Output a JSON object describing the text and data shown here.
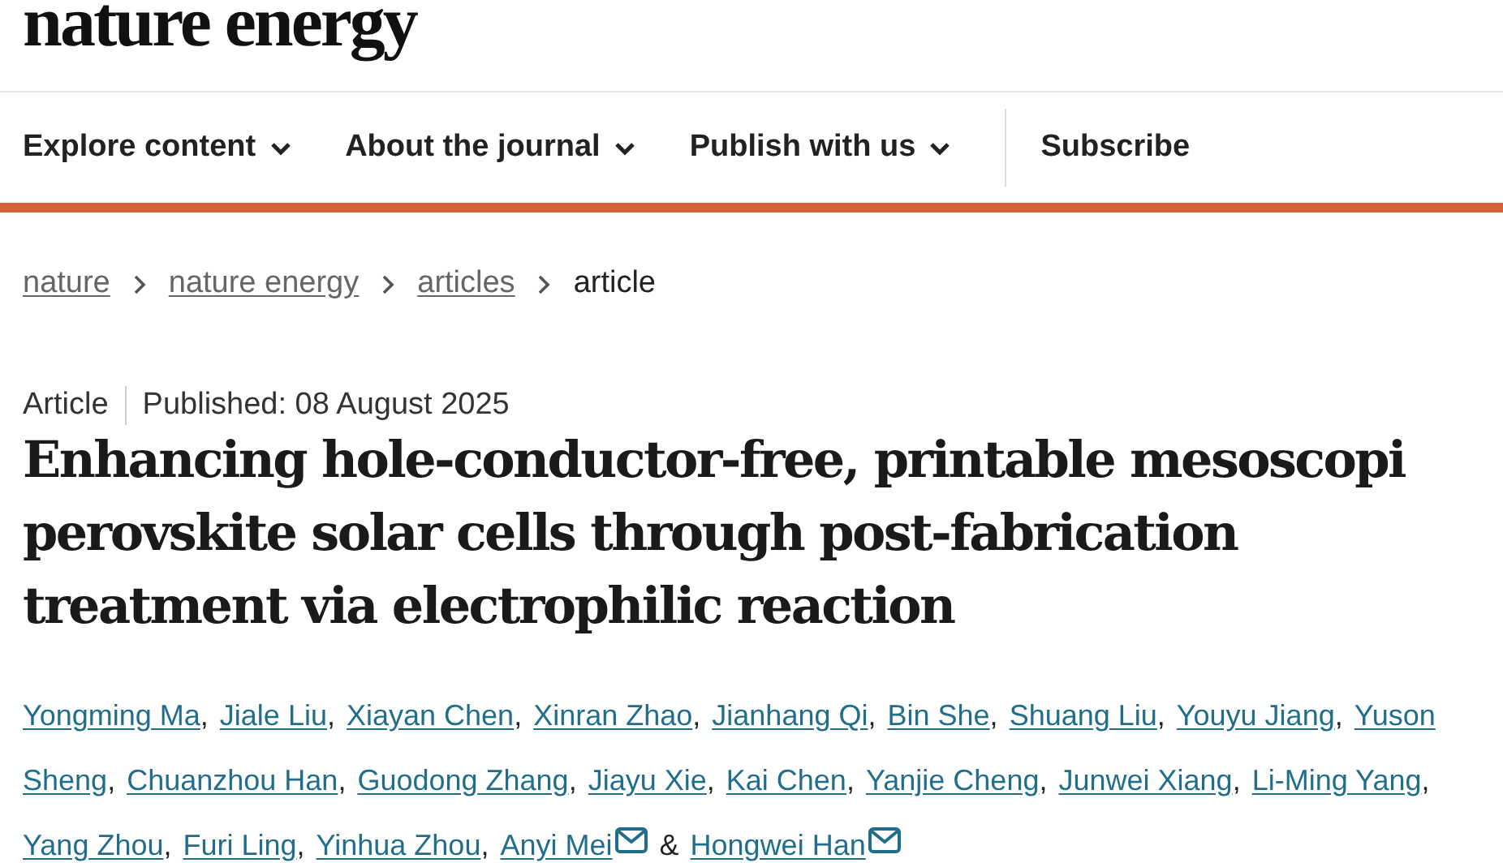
{
  "logo": "nature energy",
  "nav": [
    {
      "label": "Explore content",
      "dropdown": true
    },
    {
      "label": "About the journal",
      "dropdown": true
    },
    {
      "label": "Publish with us",
      "dropdown": true
    },
    {
      "label": "Subscribe",
      "dropdown": false
    }
  ],
  "breadcrumbs": [
    {
      "label": "nature",
      "link": true
    },
    {
      "label": "nature energy",
      "link": true
    },
    {
      "label": "articles",
      "link": true
    },
    {
      "label": "article",
      "link": false
    }
  ],
  "article_type": "Article",
  "published": "Published: 08 August 2025",
  "title_lines": [
    "Enhancing hole-conductor-free, printable mesoscopi",
    "perovskite solar cells through post-fabrication",
    "treatment via electrophilic reaction"
  ],
  "author_lines": [
    [
      {
        "name": "Yongming Ma",
        "sep": ",",
        "email": false
      },
      {
        "name": "Jiale Liu",
        "sep": ",",
        "email": false
      },
      {
        "name": "Xiayan Chen",
        "sep": ",",
        "email": false
      },
      {
        "name": "Xinran Zhao",
        "sep": ",",
        "email": false
      },
      {
        "name": "Jianhang Qi",
        "sep": ",",
        "email": false
      },
      {
        "name": "Bin She",
        "sep": ",",
        "email": false
      },
      {
        "name": "Shuang Liu",
        "sep": ",",
        "email": false
      },
      {
        "name": "Youyu Jiang",
        "sep": ",",
        "email": false
      },
      {
        "name": "Yuson",
        "email": false
      }
    ],
    [
      {
        "name": "Sheng",
        "sep": ",",
        "email": false
      },
      {
        "name": "Chuanzhou Han",
        "sep": ",",
        "email": false
      },
      {
        "name": "Guodong Zhang",
        "sep": ",",
        "email": false
      },
      {
        "name": "Jiayu Xie",
        "sep": ",",
        "email": false
      },
      {
        "name": "Kai Chen",
        "sep": ",",
        "email": false
      },
      {
        "name": "Yanjie Cheng",
        "sep": ",",
        "email": false
      },
      {
        "name": "Junwei Xiang",
        "sep": ",",
        "email": false
      },
      {
        "name": "Li-Ming Yang",
        "sep": ",",
        "email": false
      }
    ],
    [
      {
        "name": "Yang Zhou",
        "sep": ",",
        "email": false
      },
      {
        "name": "Furi Ling",
        "sep": ",",
        "email": false
      },
      {
        "name": "Yinhua Zhou",
        "sep": ",",
        "email": false
      },
      {
        "name": "Anyi Mei",
        "sep": "&",
        "email": true
      },
      {
        "name": "Hongwei Han",
        "email": true
      }
    ]
  ]
}
